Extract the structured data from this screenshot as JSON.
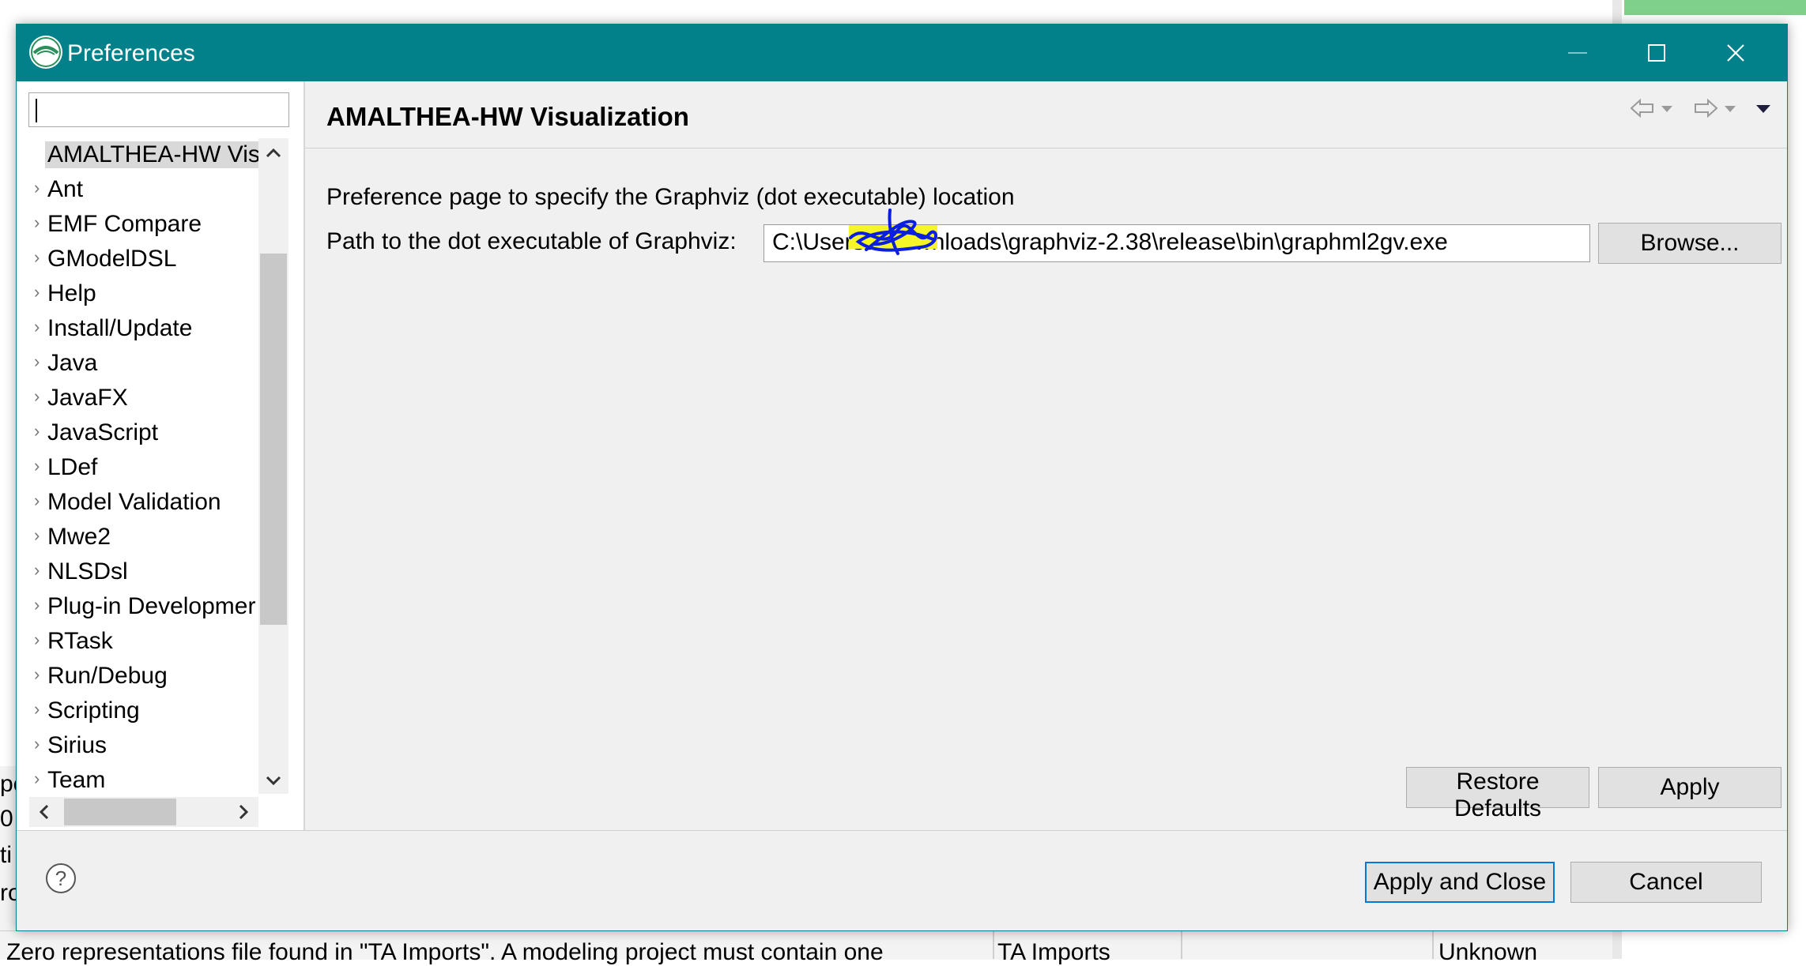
{
  "dialog": {
    "title": "Preferences",
    "window_buttons": {
      "minimize": "minimize",
      "maximize": "maximize",
      "close": "close"
    }
  },
  "sidebar": {
    "filter_value": "",
    "items": [
      {
        "label": "AMALTHEA-HW Visu",
        "selected": true,
        "has_children": false
      },
      {
        "label": "Ant",
        "has_children": true
      },
      {
        "label": "EMF Compare",
        "has_children": true
      },
      {
        "label": "GModelDSL",
        "has_children": true
      },
      {
        "label": "Help",
        "has_children": true
      },
      {
        "label": "Install/Update",
        "has_children": true
      },
      {
        "label": "Java",
        "has_children": true
      },
      {
        "label": "JavaFX",
        "has_children": true
      },
      {
        "label": "JavaScript",
        "has_children": true
      },
      {
        "label": "LDef",
        "has_children": true
      },
      {
        "label": "Model Validation",
        "has_children": true
      },
      {
        "label": "Mwe2",
        "has_children": true
      },
      {
        "label": "NLSDsl",
        "has_children": true
      },
      {
        "label": "Plug-in Developmer",
        "has_children": true
      },
      {
        "label": "RTask",
        "has_children": true
      },
      {
        "label": "Run/Debug",
        "has_children": true
      },
      {
        "label": "Scripting",
        "has_children": true
      },
      {
        "label": "Sirius",
        "has_children": true
      },
      {
        "label": "Team",
        "has_children": true
      }
    ]
  },
  "page": {
    "title": "AMALTHEA-HW Visualization",
    "description": "Preference page to specify the Graphviz (dot executable) location",
    "path_label": "Path to the dot executable of Graphviz:",
    "path_value": "C:\\Users\\          \\Downloads\\graphviz-2.38\\release\\bin\\graphml2gv.exe",
    "browse_label": "Browse...",
    "restore_defaults_label": "Restore Defaults",
    "apply_label": "Apply"
  },
  "footer": {
    "apply_close_label": "Apply and Close",
    "cancel_label": "Cancel"
  },
  "background": {
    "bottom_row": {
      "message": "Zero representations file found in \"TA Imports\". A modeling project must contain one",
      "project": "TA Imports",
      "status": "Unknown"
    },
    "left_fragments": [
      "pe",
      "0",
      "ti",
      "ro"
    ]
  },
  "colors": {
    "titlebar": "#03818a",
    "selection": "#d9d9d9",
    "primary_border": "#0078d7",
    "scribble": "#0a1ee0",
    "highlight": "#f5f52a"
  }
}
